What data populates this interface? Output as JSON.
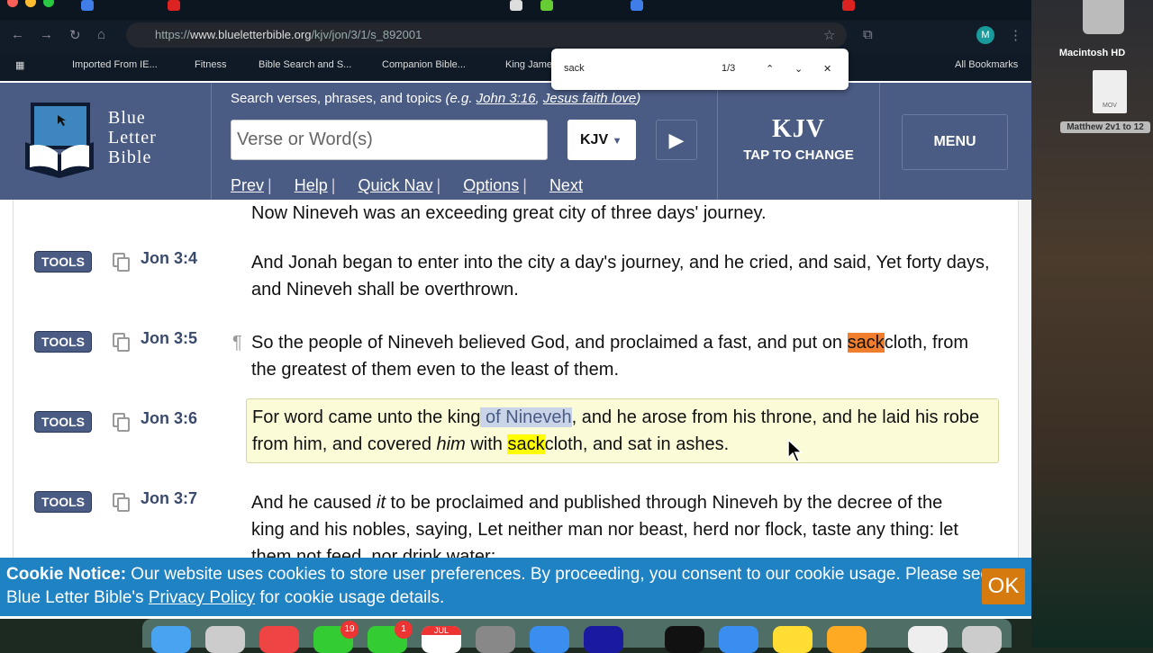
{
  "browser": {
    "url_prefix": "https://",
    "url_domain": "www.blueletterbible.org",
    "url_path": "/kjv/jon/3/1/s_892001",
    "bookmarks": [
      "Imported From IE...",
      "Fitness",
      "Bible Search and S...",
      "Companion Bible...",
      "King James",
      "All Bookmarks"
    ],
    "find": {
      "query": "sack",
      "count": "1/3"
    },
    "profile": "M"
  },
  "header": {
    "logo_lines": [
      "Blue",
      "Letter",
      "Bible"
    ],
    "search_hint": "Search verses, phrases, and topics ",
    "hint_eg": "(e.g. ",
    "hint_link1": "John 3:16",
    "hint_comma": ", ",
    "hint_link2": "Jesus faith love",
    "hint_close": ")",
    "search_placeholder": "Verse or Word(s)",
    "version": "KJV",
    "links": [
      "Prev",
      "Help",
      "Quick Nav",
      "Options",
      "Next"
    ],
    "kjv_big": "KJV",
    "kjv_small": "TAP TO CHANGE",
    "menu": "MENU"
  },
  "verses": {
    "tools_label": "TOOLS",
    "v3_tail": "Now Nineveh was an exceeding great city of three days' journey.",
    "v4": {
      "ref": "Jon 3:4",
      "text": "And Jonah began to enter into the city a day's journey, and he cried, and said, Yet forty days, and Nineveh shall be overthrown."
    },
    "v5": {
      "ref": "Jon 3:5",
      "pilcrow": "¶",
      "a": "So the people of Nineveh believed God, and proclaimed a fast, and put on ",
      "m": "sack",
      "b": "cloth, from the greatest of them even to the least of them."
    },
    "v6": {
      "ref": "Jon 3:6",
      "a": "For word came unto the king",
      "s": " of Nineveh",
      "b": ", and he arose from his throne, and he laid his robe from him, and covered ",
      "i": "him",
      "c": " with ",
      "m": "sack",
      "d": "cloth, and sat in ashes."
    },
    "v7": {
      "ref": "Jon 3:7",
      "a": "And he caused ",
      "i": "it",
      "b": " to be proclaimed and published through Nineveh by the decree of the king and his nobles, saying, Let neither man nor beast, herd nor flock, taste any thing: let them not feed, nor drink water:"
    }
  },
  "cookie": {
    "title": "Cookie Notice:",
    "text1": " Our website uses cookies to store user preferences. By proceeding, you consent to our cookie usage. Please see Blue Letter Bible's ",
    "link": "Privacy Policy",
    "text2": " for cookie usage details.",
    "ok": "OK"
  },
  "desktop": {
    "hd": "Macintosh HD",
    "file_ext": "MOV",
    "file": "Matthew 2v1 to 12"
  },
  "dock": {
    "badge_messages": "19",
    "badge_facetime": "1",
    "calendar_month": "JUL"
  }
}
